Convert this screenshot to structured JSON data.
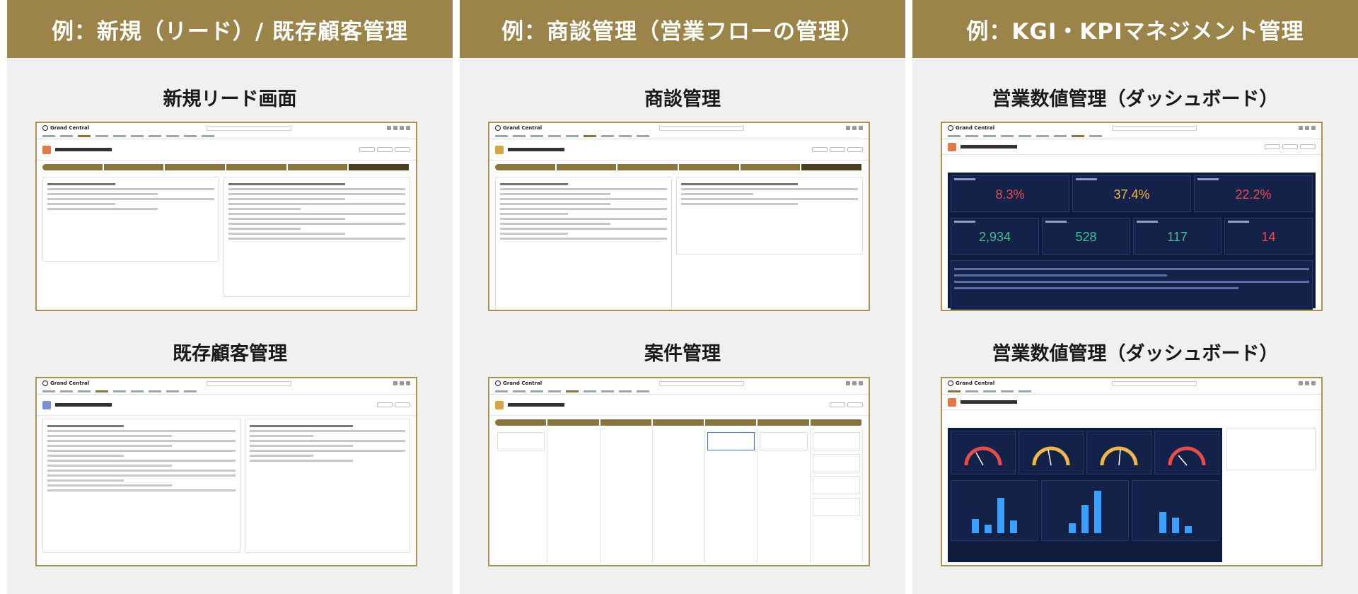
{
  "columns": [
    {
      "header": "例：新規（リード）/ 既存顧客管理",
      "captions": [
        "新規リード画面",
        "既存顧客管理"
      ]
    },
    {
      "header": "例：商談管理（営業フローの管理）",
      "captions": [
        "商談管理",
        "案件管理"
      ]
    },
    {
      "header": "例：KGI・KPIマネジメント管理",
      "captions": [
        "営業数値管理（ダッシュボード）",
        "営業数値管理（ダッシュボード）"
      ]
    }
  ],
  "app": {
    "logo_text": "Grand Central"
  },
  "dashboard": {
    "tiles_row1": [
      {
        "value": "8.3%",
        "color": "#e84b4b"
      },
      {
        "value": "37.4%",
        "color": "#f0b84a"
      },
      {
        "value": "22.2%",
        "color": "#e84b4b"
      }
    ],
    "tiles_row2": [
      {
        "value": "2,934",
        "color": "#3fbf8f"
      },
      {
        "value": "528",
        "color": "#3fbf8f"
      },
      {
        "value": "117",
        "color": "#3fbf8f"
      },
      {
        "value": "14",
        "color": "#e84b4b"
      }
    ]
  },
  "colors": {
    "header_bg": "#9a8449",
    "frame_border": "#a89152",
    "column_bg": "#f0f0f0"
  }
}
